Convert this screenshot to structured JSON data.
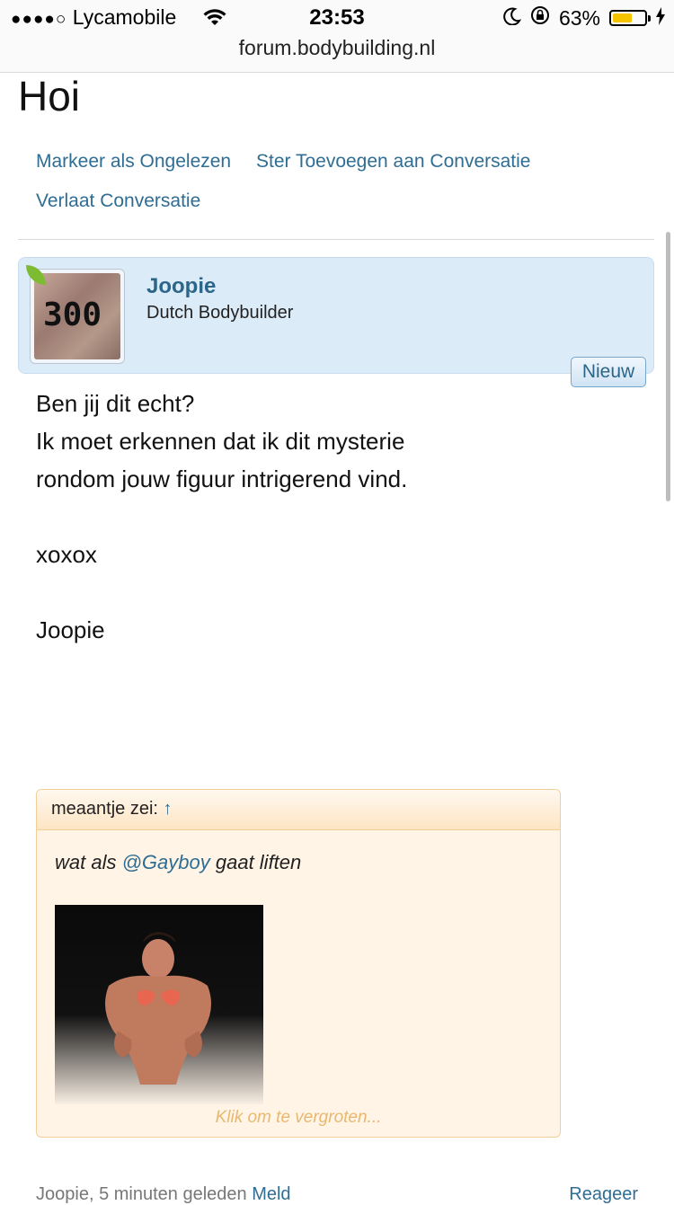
{
  "status_bar": {
    "signal_dots": "●●●●○",
    "carrier": "Lycamobile",
    "time": "23:53",
    "battery_percent": "63%",
    "battery_level": 0.63,
    "url": "forum.bodybuilding.nl"
  },
  "page": {
    "title": "Hoi",
    "actions": {
      "mark_unread": "Markeer als Ongelezen",
      "star": "Ster Toevoegen aan Conversatie",
      "leave": "Verlaat Conversatie"
    }
  },
  "message": {
    "author": "Joopie",
    "author_title": "Dutch Bodybuilder",
    "avatar_text": "300",
    "new_label": "Nieuw",
    "lines": [
      "Ben jij dit echt?",
      "Ik moet erkennen dat ik dit mysterie",
      "rondom jouw figuur intrigerend vind.",
      "xoxox",
      "Joopie"
    ],
    "quote": {
      "author": "meaantje zei:",
      "arrow": "↑",
      "text_before": "wat als ",
      "mention": "@Gayboy",
      "text_after": " gaat liften",
      "enlarge_label": "Klik om te vergroten..."
    },
    "footer": {
      "author": "Joopie",
      "separator": ",",
      "time": "5 minuten geleden",
      "report": "Meld",
      "reply": "Reageer"
    }
  }
}
